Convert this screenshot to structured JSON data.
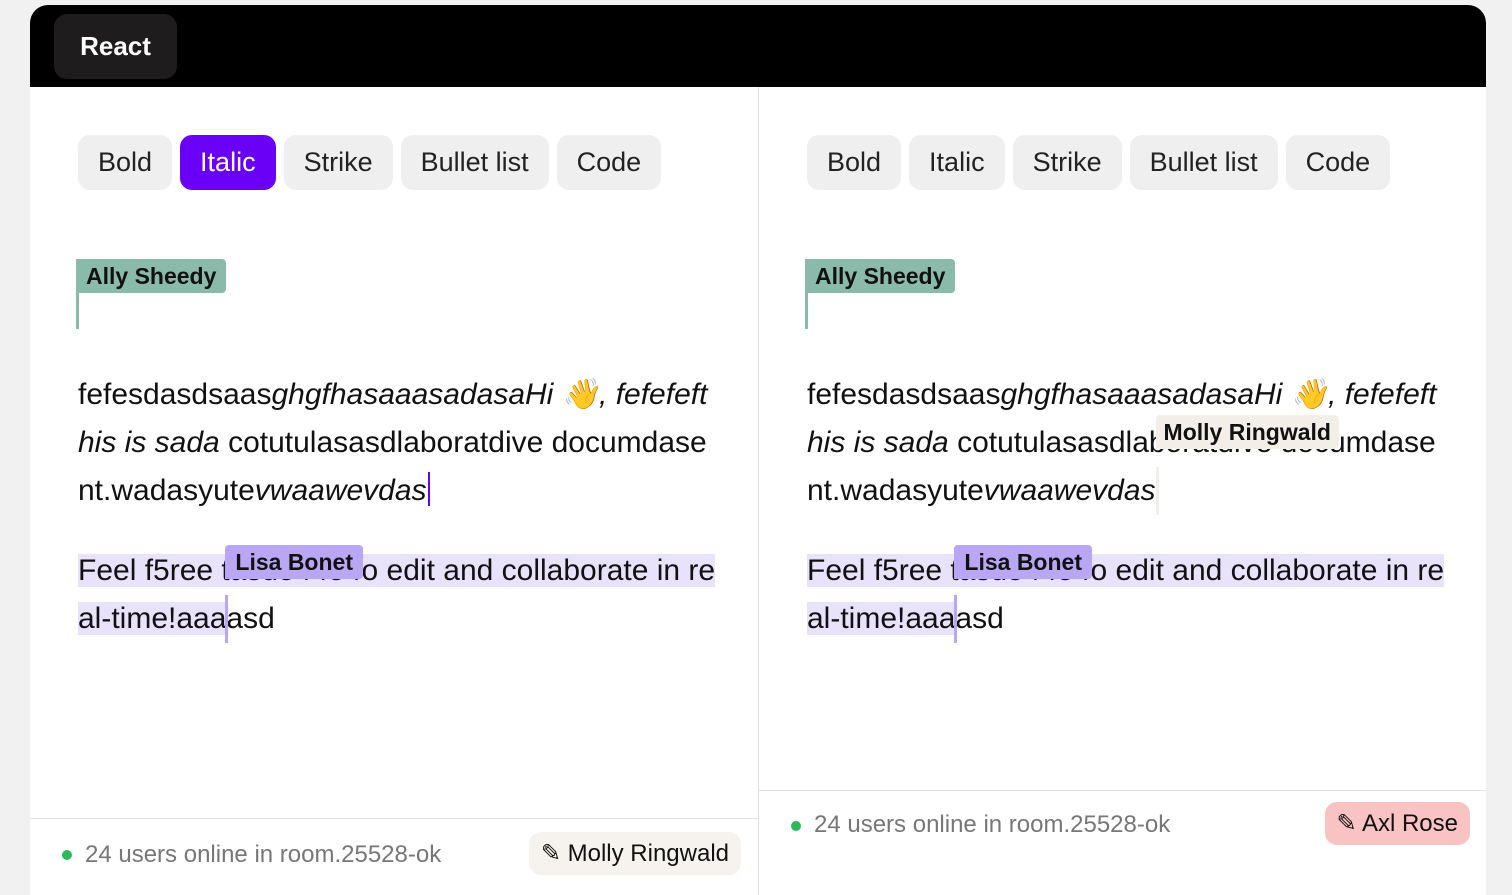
{
  "header": {
    "framework_tab": "React"
  },
  "toolbar_labels": {
    "bold": "Bold",
    "italic": "Italic",
    "strike": "Strike",
    "bullet_list": "Bullet list",
    "code": "Code"
  },
  "colors": {
    "active_button": "#6a00f5",
    "ally_sheedy_cursor": "#8abaa9",
    "lisa_bonet_cursor": "#b9a7f5",
    "molly_ringwald_cursor": "#f4eee9",
    "axl_rose_chip": "#f9c3c3",
    "online_dot": "#2eb85c"
  },
  "cursors": {
    "ally": "Ally Sheedy",
    "lisa": "Lisa Bonet",
    "molly": "Molly Ringwald"
  },
  "document": {
    "p1_run1": "fefesdasdsaas",
    "p1_run2": "ghgfhasaaasadasaHi 👋, fefefefthis is sada",
    "p1_run3": " cotutulasasdlaboratdive documdasent.wadasyute",
    "p1_run4": "vwaawevdas",
    "p2_highlighted": "Feel f5ree tasd54454o edit and collaborate in real-time!aaa",
    "p2_tail": "asd"
  },
  "panes": [
    {
      "active_button": "Italic",
      "status_text": "24 users online in room.25528-ok",
      "current_user": "✎ Molly Ringwald"
    },
    {
      "active_button": "",
      "status_text": "24 users online in room.25528-ok",
      "current_user": "✎ Axl Rose"
    }
  ]
}
